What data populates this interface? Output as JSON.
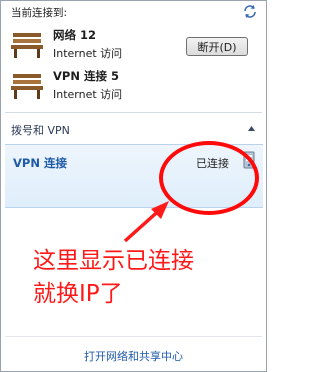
{
  "header": {
    "title": "当前连接到:"
  },
  "networks": [
    {
      "name": "网络  12",
      "status": "Internet 访问"
    },
    {
      "name": "VPN 连接  5",
      "status": "Internet 访问"
    }
  ],
  "section": {
    "label": "拨号和 VPN"
  },
  "vpn": {
    "name": "VPN 连接",
    "status": "已连接",
    "disconnect_label": "断开(D)"
  },
  "annotation": {
    "line1": "这里显示已连接",
    "line2": "就换IP了"
  },
  "footer": {
    "link": "打开网络和共享中心"
  },
  "colors": {
    "annotation": "#ff1a1a",
    "link": "#1e5aa8",
    "panel": "#e6f1fc"
  }
}
